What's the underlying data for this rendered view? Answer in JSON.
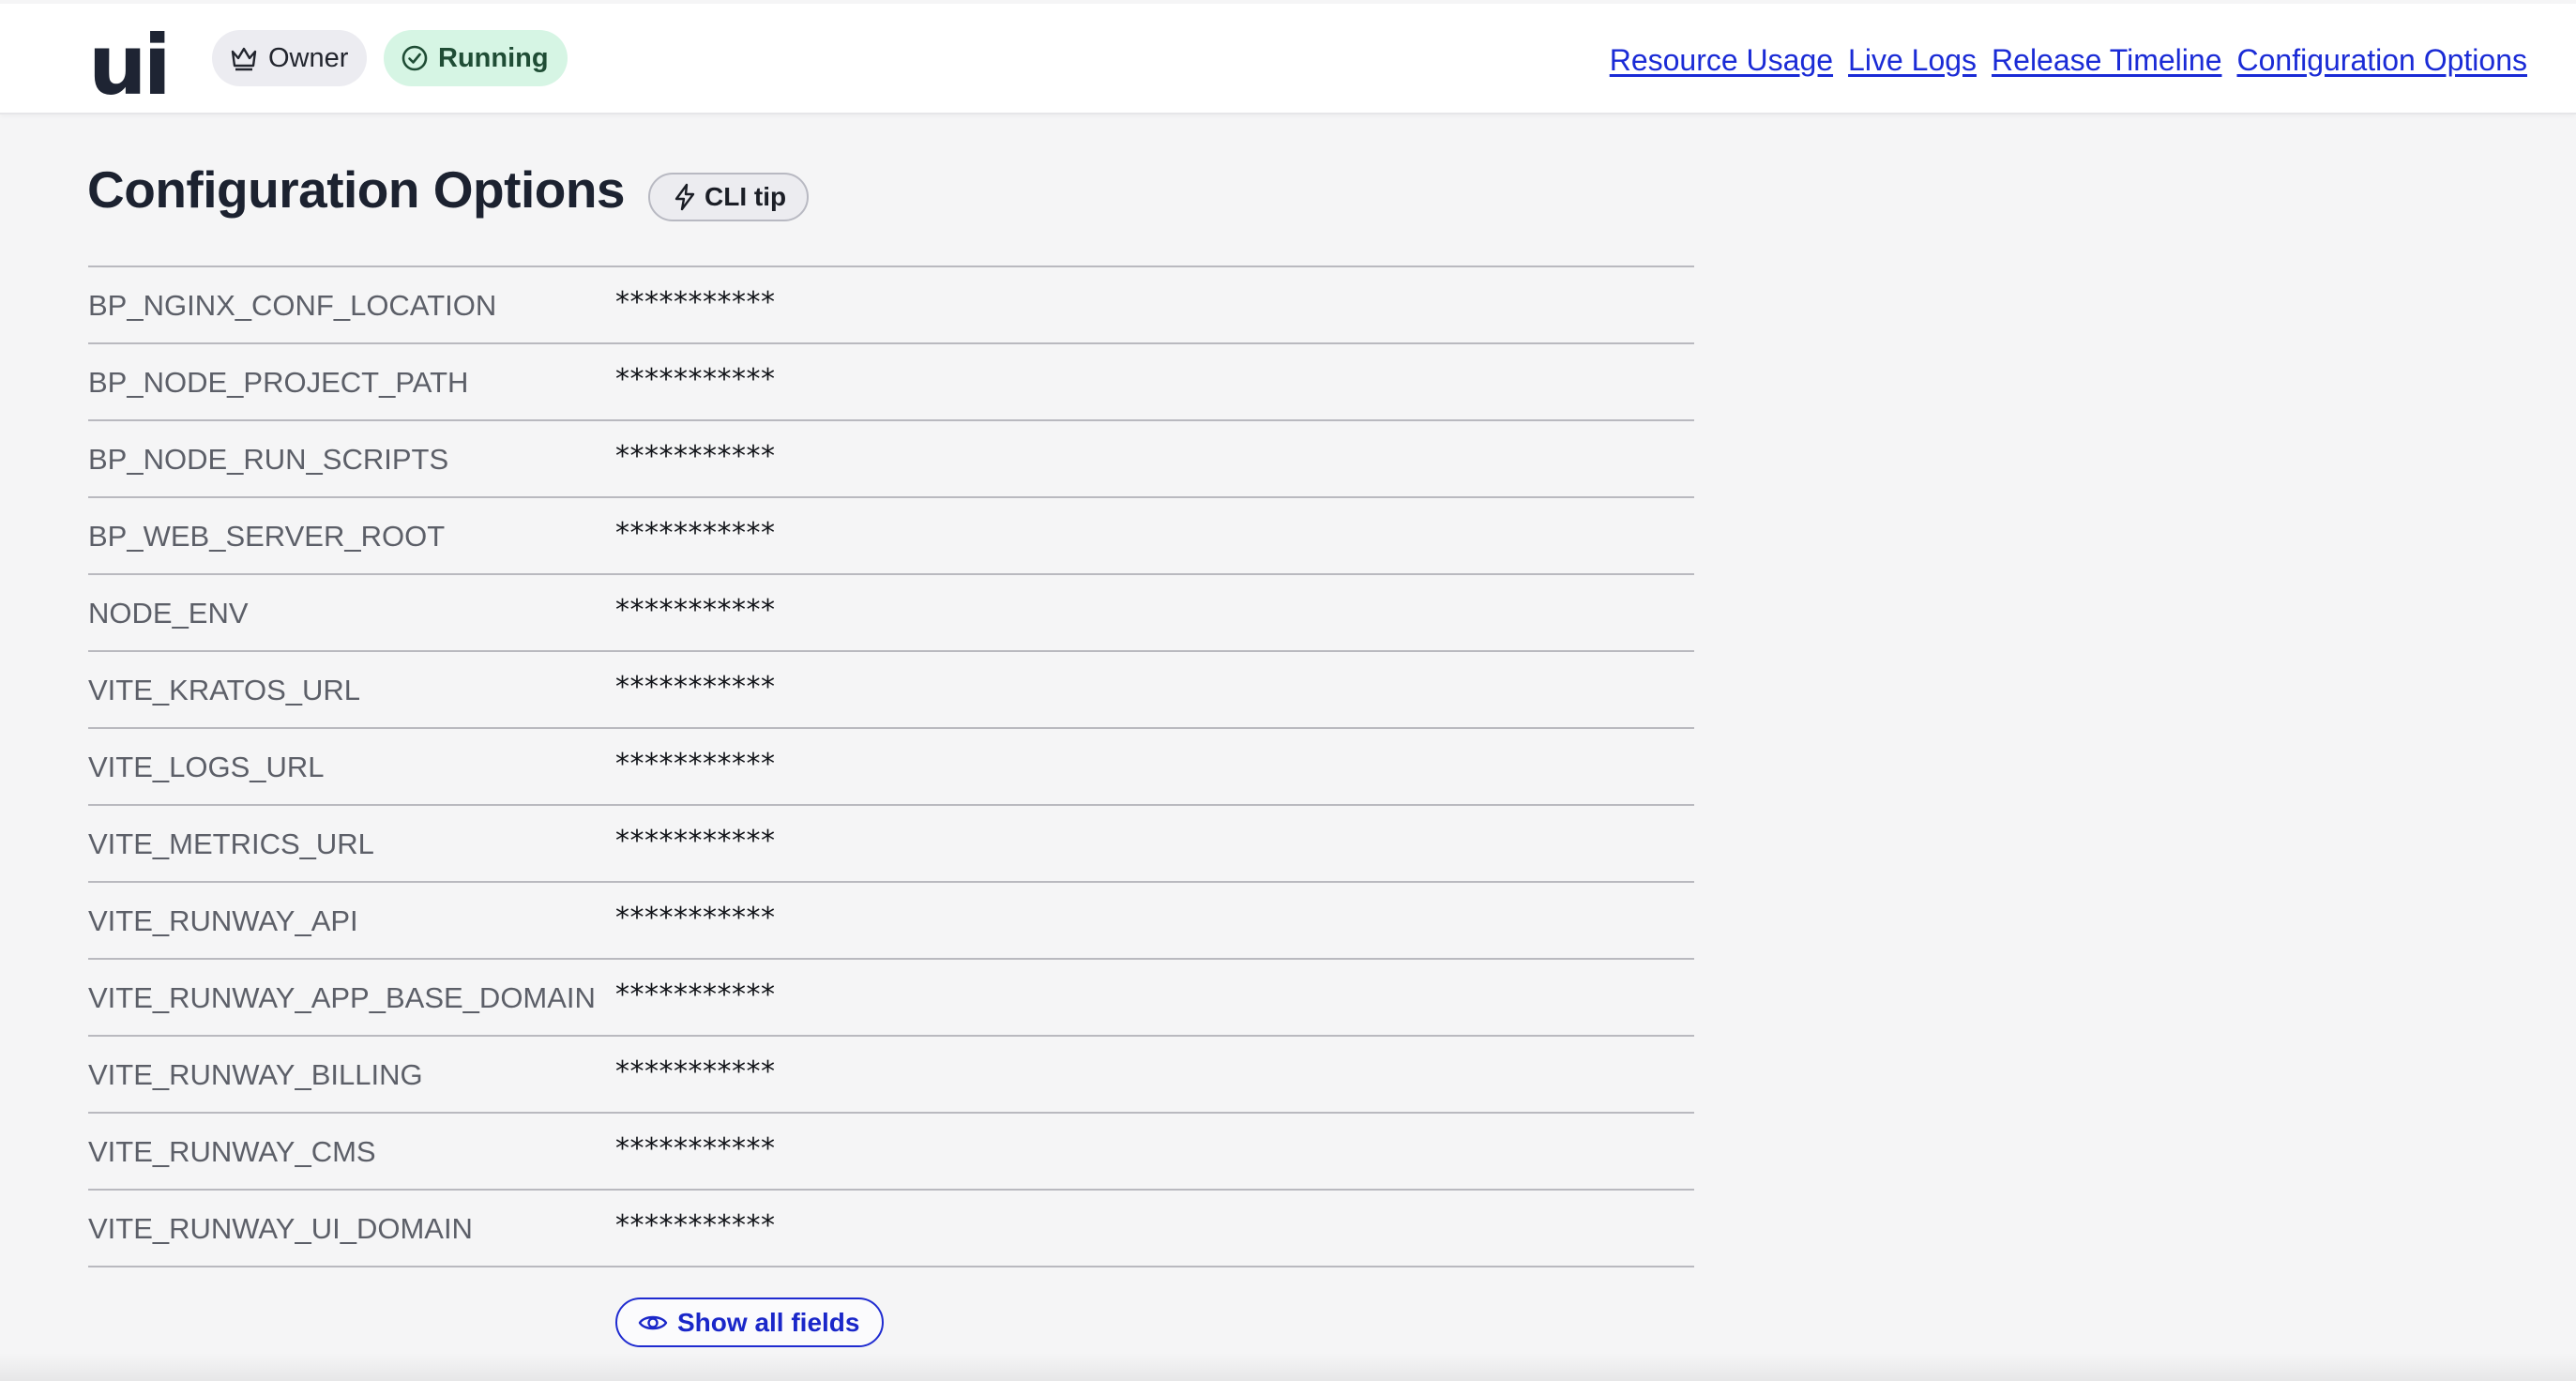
{
  "header": {
    "logo_text": "ui",
    "role_badge": "Owner",
    "status_badge": "Running",
    "nav": [
      {
        "label": "Resource Usage"
      },
      {
        "label": "Live Logs"
      },
      {
        "label": "Release Timeline"
      },
      {
        "label": "Configuration Options"
      }
    ]
  },
  "main": {
    "title": "Configuration Options",
    "cli_tip_label": "CLI tip",
    "rows": [
      {
        "key": "BP_NGINX_CONF_LOCATION",
        "value": "***********"
      },
      {
        "key": "BP_NODE_PROJECT_PATH",
        "value": "***********"
      },
      {
        "key": "BP_NODE_RUN_SCRIPTS",
        "value": "***********"
      },
      {
        "key": "BP_WEB_SERVER_ROOT",
        "value": "***********"
      },
      {
        "key": "NODE_ENV",
        "value": "***********"
      },
      {
        "key": "VITE_KRATOS_URL",
        "value": "***********"
      },
      {
        "key": "VITE_LOGS_URL",
        "value": "***********"
      },
      {
        "key": "VITE_METRICS_URL",
        "value": "***********"
      },
      {
        "key": "VITE_RUNWAY_API",
        "value": "***********"
      },
      {
        "key": "VITE_RUNWAY_APP_BASE_DOMAIN",
        "value": "***********"
      },
      {
        "key": "VITE_RUNWAY_BILLING",
        "value": "***********"
      },
      {
        "key": "VITE_RUNWAY_CMS",
        "value": "***********"
      },
      {
        "key": "VITE_RUNWAY_UI_DOMAIN",
        "value": "***********"
      }
    ],
    "show_all_label": "Show all fields"
  },
  "colors": {
    "link": "#1a2bd6",
    "running_bg": "#d6f5e4",
    "owner_bg": "#ececf1",
    "page_bg": "#f5f5f6"
  },
  "icons": {
    "owner": "crown-icon",
    "running": "check-circle-icon",
    "cli_tip": "lightning-icon",
    "show_all": "eye-icon"
  }
}
